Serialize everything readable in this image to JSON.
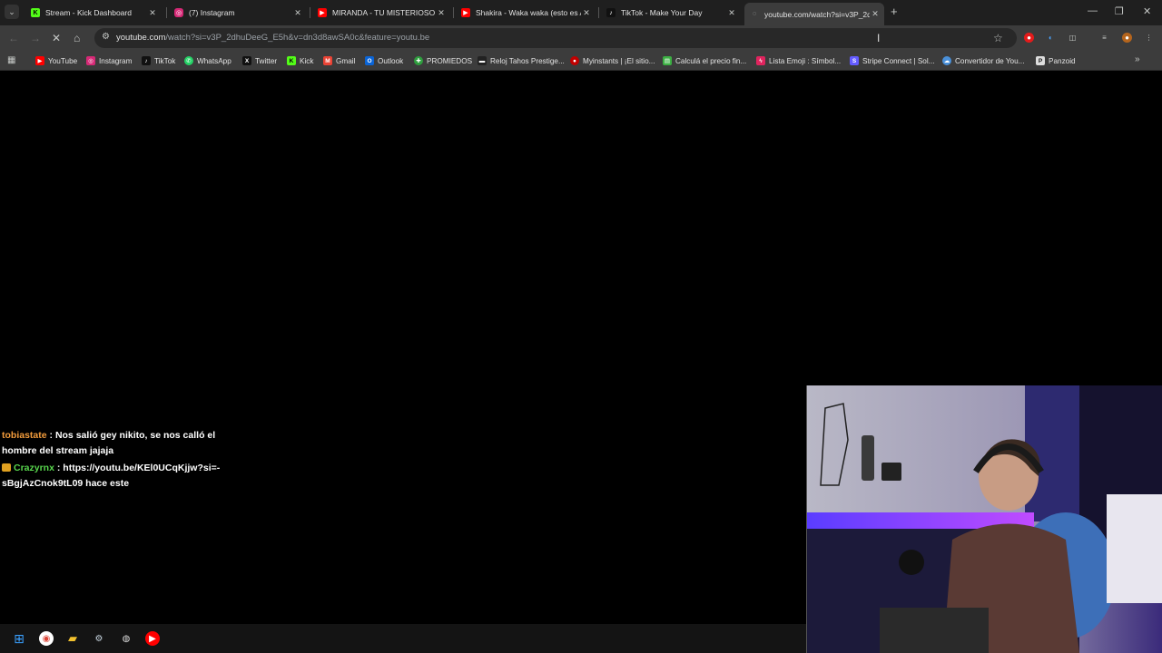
{
  "tabs": [
    {
      "title": "Stream - Kick Dashboard",
      "icon": "kick-icon",
      "active": false
    },
    {
      "title": "(7) Instagram",
      "icon": "instagram-icon",
      "active": false
    },
    {
      "title": "MIRANDA - TU MISTERIOSO A",
      "icon": "youtube-icon",
      "active": false
    },
    {
      "title": "Shakira - Waka waka (esto es A",
      "icon": "youtube-icon",
      "active": false
    },
    {
      "title": "TikTok - Make Your Day",
      "icon": "tiktok-icon",
      "active": false
    },
    {
      "title": "youtube.com/watch?si=v3P_2d",
      "icon": "loading-icon",
      "active": true
    }
  ],
  "address_bar": {
    "host": "youtube.com",
    "path": "/watch?si=v3P_2dhuDeeG_E5h&v=dn3d8awSA0c&feature=youtu.be"
  },
  "bookmarks": [
    {
      "label": "YouTube",
      "icon": "youtube-icon",
      "color": "#ff0000"
    },
    {
      "label": "Instagram",
      "icon": "instagram-icon",
      "color": "#d62976"
    },
    {
      "label": "TikTok",
      "icon": "tiktok-icon",
      "color": "#111111"
    },
    {
      "label": "WhatsApp",
      "icon": "whatsapp-icon",
      "color": "#25d366"
    },
    {
      "label": "Twitter",
      "icon": "x-icon",
      "color": "#111111"
    },
    {
      "label": "Kick",
      "icon": "kick-icon",
      "color": "#53fc18"
    },
    {
      "label": "Gmail",
      "icon": "gmail-icon",
      "color": "#ea4335"
    },
    {
      "label": "Outlook",
      "icon": "outlook-icon",
      "color": "#0a64d6"
    },
    {
      "label": "PROMIEDOS",
      "icon": "promiedos-icon",
      "color": "#2e9e3e"
    },
    {
      "label": "Reloj Tahos Prestige...",
      "icon": "tahos-icon",
      "color": "#222222"
    },
    {
      "label": "Myinstants | ¡El sitio...",
      "icon": "myinstants-icon",
      "color": "#c00000"
    },
    {
      "label": "Calculá el precio fin...",
      "icon": "calculator-icon",
      "color": "#3cb043"
    },
    {
      "label": "Lista Emoji : Símbol...",
      "icon": "emoji-icon",
      "color": "#e0245e"
    },
    {
      "label": "Stripe Connect | Sol...",
      "icon": "stripe-icon",
      "color": "#635bff"
    },
    {
      "label": "Convertidor de You...",
      "icon": "converter-icon",
      "color": "#4a90d9"
    },
    {
      "label": "Panzoid",
      "icon": "panzoid-icon",
      "color": "#dddddd"
    }
  ],
  "chat": [
    {
      "user": "tobiastate",
      "text": "Nos salió gey nikito, se nos calló el hombre del stream jajaja",
      "badge": false
    },
    {
      "user": "Crazyrnx",
      "text": "https://youtu.be/KEl0UCqKjjw?si=-sBgjAzCnok9tL09 hace este",
      "badge": true
    }
  ],
  "colors": {
    "tabstrip": "#1f1f1f",
    "toolbar": "#3c3c3c",
    "omnibox": "#282828",
    "page_bg": "#000000",
    "chat_user1": "#f39c3c",
    "chat_user2": "#58d64d"
  },
  "taskbar_icons": [
    "windows-start-icon",
    "chrome-icon",
    "file-explorer-icon",
    "steam-icon",
    "obs-icon",
    "youtube-app-icon"
  ]
}
